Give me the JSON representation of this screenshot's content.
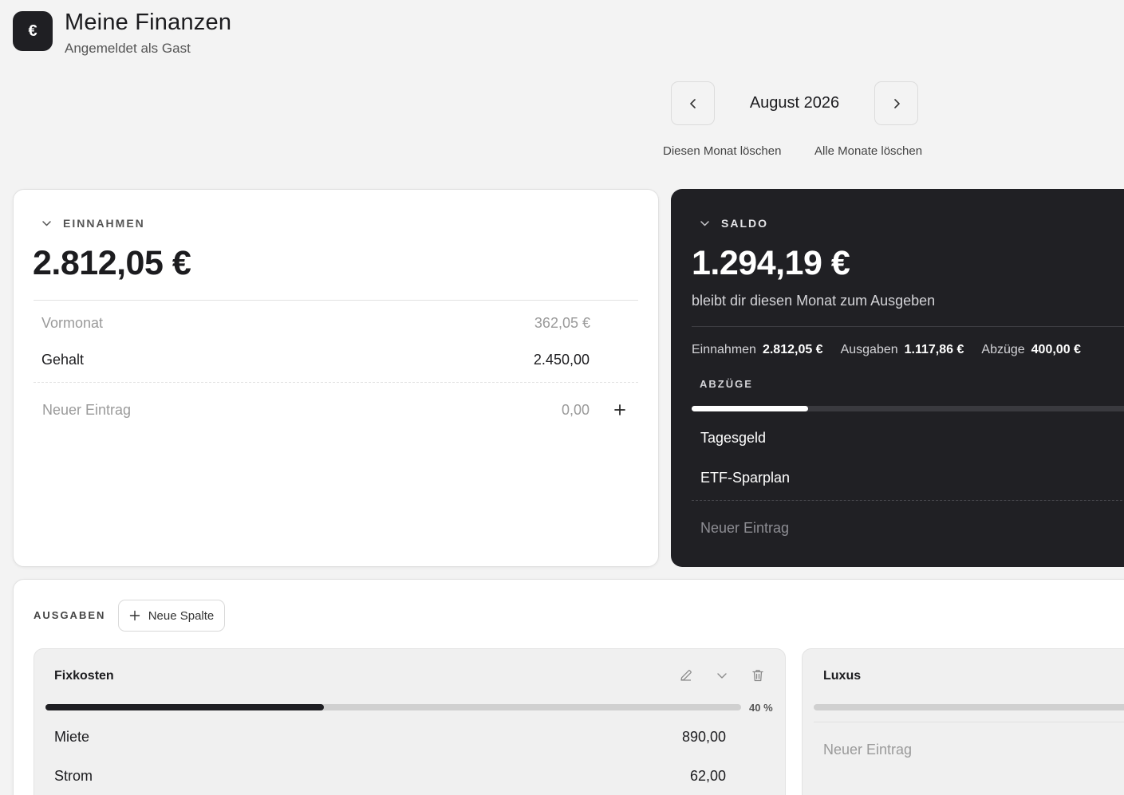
{
  "header": {
    "logo_symbol": "€",
    "title": "Meine Finanzen",
    "subtitle": "Angemeldet als Gast"
  },
  "month_nav": {
    "current": "August 2026",
    "prev_icon": "chevron-left-icon",
    "next_icon": "chevron-right-icon",
    "delete_month": "Diesen Monat löschen",
    "delete_all": "Alle Monate löschen"
  },
  "income": {
    "heading": "EINNAHMEN",
    "total": "2.812,05 €",
    "items": [
      {
        "label": "Vormonat",
        "value": "362,05 €",
        "muted": true
      },
      {
        "label": "Gehalt",
        "value": "2.450,00",
        "muted": false
      }
    ],
    "new_entry_placeholder": "Neuer Eintrag",
    "new_entry_value": "0,00"
  },
  "balance": {
    "heading": "SALDO",
    "total": "1.294,19 €",
    "caption": "bleibt dir diesen Monat zum Ausgeben",
    "stats": [
      {
        "label": "Einnahmen",
        "value": "2.812,05 €"
      },
      {
        "label": "Ausgaben",
        "value": "1.117,86 €"
      },
      {
        "label": "Abzüge",
        "value": "400,00 €"
      }
    ],
    "deductions_heading": "ABZÜGE",
    "deductions_progress": 0.26,
    "deductions": [
      "Tagesgeld",
      "ETF-Sparplan"
    ],
    "new_entry_placeholder": "Neuer Eintrag"
  },
  "expenses": {
    "heading": "AUSGABEN",
    "new_column_label": "Neue Spalte",
    "columns": [
      {
        "title": "Fixkosten",
        "progress": 0.4,
        "percent_label": "40 %",
        "items": [
          {
            "label": "Miete",
            "value": "890,00"
          },
          {
            "label": "Strom",
            "value": "62,00"
          }
        ]
      },
      {
        "title": "Luxus",
        "progress": 0,
        "new_entry_placeholder": "Neuer Eintrag"
      }
    ]
  },
  "colors": {
    "background": "#f3f3f3",
    "dark_card": "#202024",
    "accent_dark": "#1f1f23",
    "track_light": "#d0d0d0",
    "track_dark": "#3a3a3f"
  }
}
